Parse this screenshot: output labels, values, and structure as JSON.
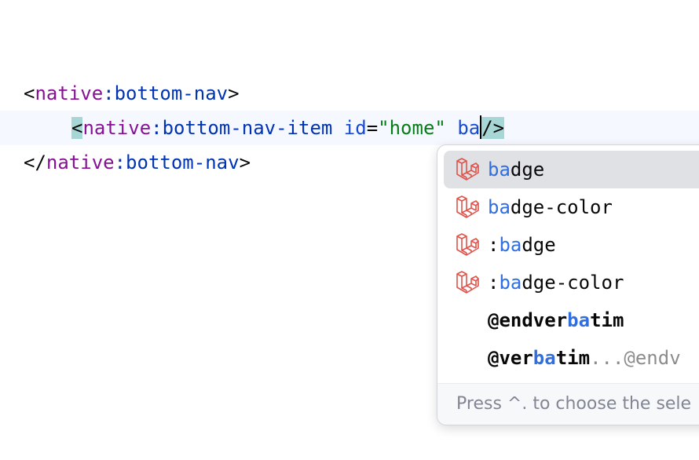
{
  "editor": {
    "line1": {
      "open_bracket": "<",
      "namespace": "native",
      "tag": ":bottom-nav",
      "close_bracket": ">"
    },
    "line2": {
      "indent": "    ",
      "open_bracket": "<",
      "namespace": "native",
      "tag": ":bottom-nav-item",
      "space": " ",
      "attr_name": "id",
      "equals": "=",
      "attr_value": "\"home\"",
      "space2": " ",
      "typed": "ba",
      "self_close": "/>"
    },
    "line3": {
      "open_bracket": "</",
      "namespace": "native",
      "tag": ":bottom-nav",
      "close_bracket": ">"
    }
  },
  "completion": {
    "items": [
      {
        "prefix": "",
        "match": "ba",
        "rest": "dge",
        "icon": "laravel-icon"
      },
      {
        "prefix": "",
        "match": "ba",
        "rest": "dge-color",
        "icon": "laravel-icon"
      },
      {
        "prefix": ":",
        "match": "ba",
        "rest": "dge",
        "icon": "laravel-icon"
      },
      {
        "prefix": ":",
        "match": "ba",
        "rest": "dge-color",
        "icon": "laravel-icon"
      },
      {
        "prefix": "@endver",
        "match": "ba",
        "rest": "tim"
      },
      {
        "prefix": "@ver",
        "match": "ba",
        "rest": "tim",
        "tail": "...@endv"
      }
    ],
    "hint": "Press ^. to choose the sele",
    "match_color": "#2f6fdf"
  }
}
